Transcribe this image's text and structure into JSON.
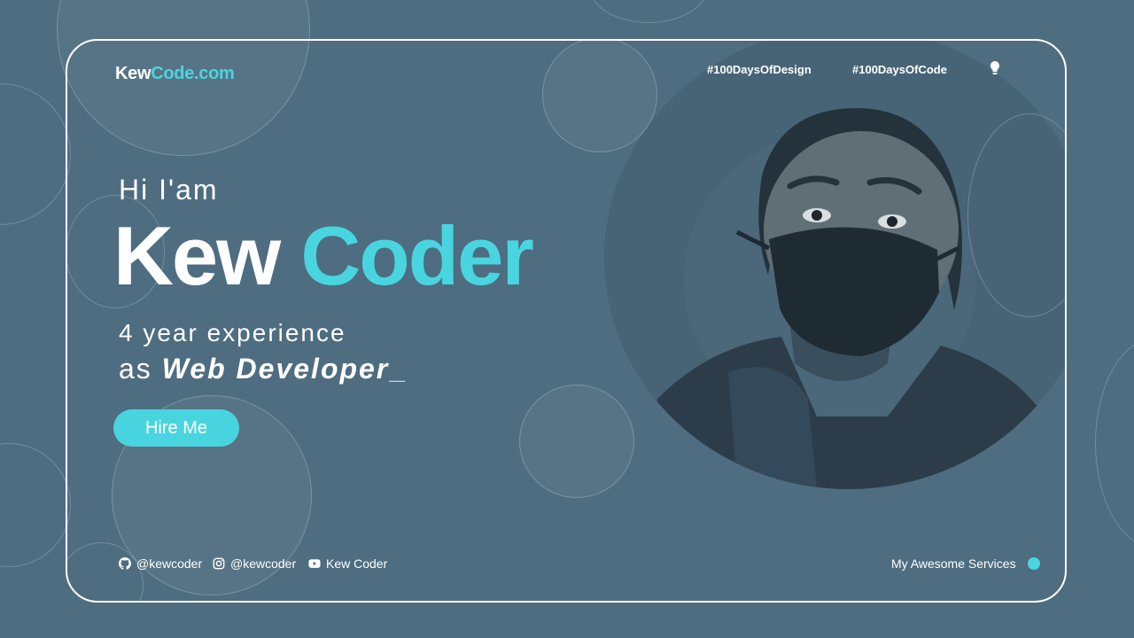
{
  "brand": {
    "part1": "Kew",
    "part2": "Code.com"
  },
  "nav": {
    "link1": "#100DaysOfDesign",
    "link2": "#100DaysOfCode",
    "theme_icon": "lightbulb-icon"
  },
  "hero": {
    "greeting": "Hi I'am",
    "name_first": "Kew",
    "name_last": "Coder",
    "experience_line1": "4 year experience",
    "experience_prefix": "as",
    "role": "Web Developer",
    "cursor": "_"
  },
  "cta": {
    "label": "Hire Me"
  },
  "footer": {
    "socials": [
      {
        "icon": "github-icon",
        "label": "@kewcoder"
      },
      {
        "icon": "instagram-icon",
        "label": "@kewcoder"
      },
      {
        "icon": "youtube-icon",
        "label": "Kew Coder"
      }
    ],
    "services_label": "My Awesome Services"
  },
  "colors": {
    "background": "#4e6d80",
    "accent": "#49d5e0",
    "text": "#ffffff"
  }
}
